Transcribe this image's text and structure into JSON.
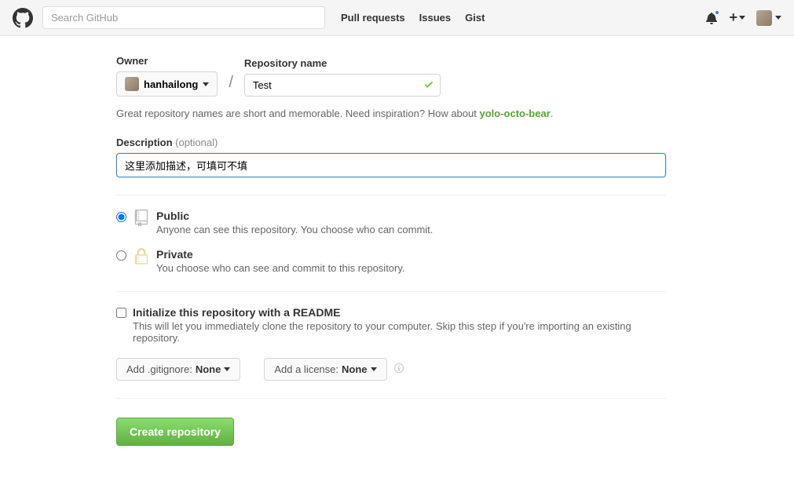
{
  "header": {
    "search_placeholder": "Search GitHub",
    "nav": {
      "pull_requests": "Pull requests",
      "issues": "Issues",
      "gist": "Gist"
    }
  },
  "form": {
    "owner_label": "Owner",
    "owner_name": "hanhailong",
    "repo_label": "Repository name",
    "repo_name_value": "Test",
    "hint_prefix": "Great repository names are short and memorable. Need inspiration? How about ",
    "hint_suggestion": "yolo-octo-bear",
    "hint_suffix": ".",
    "desc_label": "Description",
    "desc_optional": "(optional)",
    "desc_value": "这里添加描述，可填可不填",
    "public": {
      "title": "Public",
      "sub": "Anyone can see this repository. You choose who can commit."
    },
    "private": {
      "title": "Private",
      "sub": "You choose who can see and commit to this repository."
    },
    "readme": {
      "title": "Initialize this repository with a README",
      "sub": "This will let you immediately clone the repository to your computer. Skip this step if you're importing an existing repository."
    },
    "gitignore_prefix": "Add .gitignore: ",
    "gitignore_value": "None",
    "license_prefix": "Add a license: ",
    "license_value": "None",
    "submit_label": "Create repository"
  }
}
